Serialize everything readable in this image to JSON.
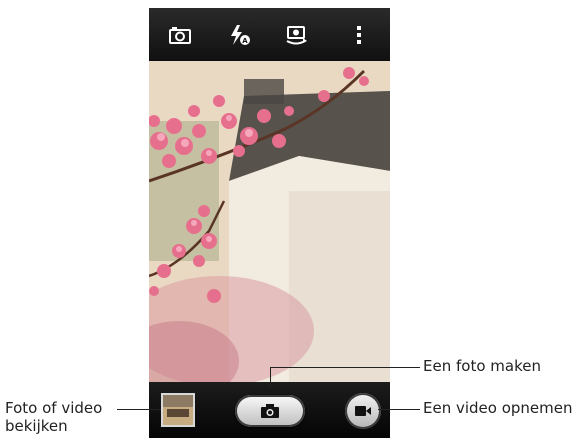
{
  "topbar": {
    "icons": [
      "camera-mode-icon",
      "flash-auto-icon",
      "switch-camera-icon",
      "more-options-icon"
    ]
  },
  "bottombar": {
    "icons": [
      "gallery-thumbnail",
      "camera-shutter-icon",
      "video-record-icon"
    ]
  },
  "callouts": {
    "take_photo": "Een foto maken",
    "record_video": "Een video opnemen",
    "view_photo_line1": "Foto of video",
    "view_photo_line2": "bekijken"
  },
  "colors": {
    "bar_background": "#111111",
    "blossom_pink": "#e76f8e",
    "callout_text": "#222222"
  }
}
